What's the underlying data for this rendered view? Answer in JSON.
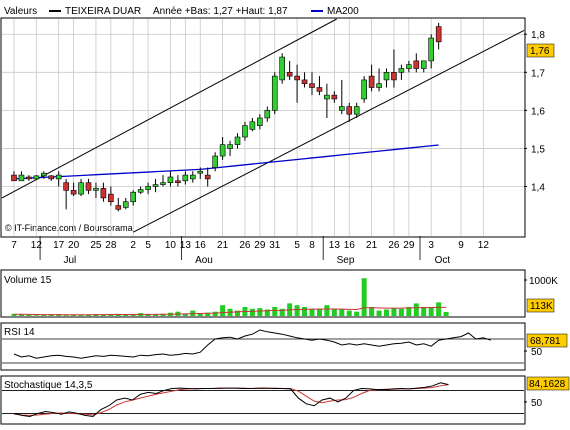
{
  "header": {
    "prefix": "Valeurs",
    "instrument": "TEIXEIRA DUAR",
    "range_text": "Année +Bas: 1,27 +Haut: 1,87",
    "ma_label": "MA200"
  },
  "watermark": "© IT-Finance.com / Boursorama",
  "colors": {
    "up": "#33cc33",
    "down": "#cc3333",
    "ma": "#0000cc",
    "grid": "#c8c8c8",
    "badge": "#ffcc00",
    "volume": "#22cc22",
    "rsi": "#000000",
    "stoch_k": "#000000",
    "stoch_d": "#cc3333"
  },
  "chart_data": [
    {
      "type": "candlestick",
      "title": "TEIXEIRA DUAR",
      "ylim": [
        1.27,
        1.84
      ],
      "y_ticks": [
        "1,8",
        "1,7",
        "1,6",
        "1,5",
        "1,4"
      ],
      "y_tick_values": [
        1.8,
        1.7,
        1.6,
        1.5,
        1.4
      ],
      "last_value_label": "1,76",
      "last_value": 1.76,
      "x_tick_labels": [
        "7",
        "12",
        "17",
        "20",
        "25",
        "28",
        "2",
        "5",
        "10",
        "13",
        "16",
        "21",
        "26",
        "29",
        "31",
        "5",
        "8",
        "13",
        "16",
        "21",
        "26",
        "29",
        "3",
        "9",
        "12"
      ],
      "x_tick_slots": [
        0,
        3,
        6,
        8,
        11,
        13,
        16,
        18,
        21,
        23,
        25,
        28,
        31,
        33,
        35,
        38,
        40,
        43,
        45,
        48,
        51,
        53,
        56,
        60,
        63
      ],
      "month_labels": [
        "Jul",
        "Aou",
        "Sep",
        "Oct"
      ],
      "month_slots": [
        7.5,
        25.5,
        44.5,
        57.5
      ],
      "month_separator_slots": [
        3.5,
        22.5,
        41.5,
        54.5
      ],
      "candles": [
        [
          1.43,
          1.44,
          1.42,
          1.415
        ],
        [
          1.415,
          1.44,
          1.42,
          1.43
        ],
        [
          1.425,
          1.43,
          1.415,
          1.42
        ],
        [
          1.42,
          1.43,
          1.42,
          1.428
        ],
        [
          1.428,
          1.44,
          1.42,
          1.435
        ],
        [
          1.428,
          1.43,
          1.415,
          1.42
        ],
        [
          1.42,
          1.44,
          1.4,
          1.43
        ],
        [
          1.41,
          1.42,
          1.34,
          1.39
        ],
        [
          1.39,
          1.41,
          1.375,
          1.38
        ],
        [
          1.38,
          1.42,
          1.375,
          1.41
        ],
        [
          1.41,
          1.42,
          1.38,
          1.39
        ],
        [
          1.39,
          1.41,
          1.37,
          1.395
        ],
        [
          1.395,
          1.41,
          1.36,
          1.37
        ],
        [
          1.38,
          1.4,
          1.35,
          1.36
        ],
        [
          1.35,
          1.37,
          1.335,
          1.34
        ],
        [
          1.345,
          1.37,
          1.34,
          1.36
        ],
        [
          1.36,
          1.39,
          1.35,
          1.385
        ],
        [
          1.385,
          1.4,
          1.38,
          1.392
        ],
        [
          1.392,
          1.41,
          1.38,
          1.4
        ],
        [
          1.4,
          1.42,
          1.385,
          1.405
        ],
        [
          1.405,
          1.43,
          1.4,
          1.41
        ],
        [
          1.41,
          1.44,
          1.4,
          1.425
        ],
        [
          1.415,
          1.43,
          1.4,
          1.41
        ],
        [
          1.415,
          1.44,
          1.405,
          1.43
        ],
        [
          1.42,
          1.44,
          1.41,
          1.43
        ],
        [
          1.435,
          1.45,
          1.42,
          1.44
        ],
        [
          1.43,
          1.45,
          1.4,
          1.42
        ],
        [
          1.45,
          1.49,
          1.44,
          1.48
        ],
        [
          1.48,
          1.53,
          1.47,
          1.51
        ],
        [
          1.5,
          1.52,
          1.48,
          1.51
        ],
        [
          1.51,
          1.54,
          1.5,
          1.53
        ],
        [
          1.53,
          1.57,
          1.52,
          1.56
        ],
        [
          1.55,
          1.58,
          1.545,
          1.57
        ],
        [
          1.56,
          1.59,
          1.55,
          1.58
        ],
        [
          1.58,
          1.61,
          1.57,
          1.6
        ],
        [
          1.6,
          1.7,
          1.59,
          1.69
        ],
        [
          1.68,
          1.75,
          1.67,
          1.74
        ],
        [
          1.7,
          1.73,
          1.68,
          1.69
        ],
        [
          1.69,
          1.72,
          1.62,
          1.68
        ],
        [
          1.68,
          1.7,
          1.66,
          1.67
        ],
        [
          1.67,
          1.7,
          1.64,
          1.66
        ],
        [
          1.66,
          1.69,
          1.64,
          1.65
        ],
        [
          1.63,
          1.67,
          1.58,
          1.64
        ],
        [
          1.64,
          1.65,
          1.62,
          1.63
        ],
        [
          1.6,
          1.68,
          1.59,
          1.61
        ],
        [
          1.61,
          1.62,
          1.57,
          1.59
        ],
        [
          1.59,
          1.62,
          1.58,
          1.61
        ],
        [
          1.63,
          1.69,
          1.62,
          1.68
        ],
        [
          1.69,
          1.72,
          1.65,
          1.66
        ],
        [
          1.66,
          1.71,
          1.65,
          1.67
        ],
        [
          1.68,
          1.71,
          1.66,
          1.7
        ],
        [
          1.7,
          1.76,
          1.66,
          1.68
        ],
        [
          1.7,
          1.72,
          1.68,
          1.71
        ],
        [
          1.71,
          1.73,
          1.7,
          1.72
        ],
        [
          1.73,
          1.75,
          1.7,
          1.71
        ],
        [
          1.71,
          1.73,
          1.7,
          1.73
        ],
        [
          1.73,
          1.8,
          1.71,
          1.79
        ],
        [
          1.82,
          1.83,
          1.76,
          1.78
        ]
      ],
      "ma200": [
        1.42,
        1.421,
        1.422,
        1.423,
        1.424,
        1.425,
        1.426,
        1.427,
        1.428,
        1.429,
        1.43,
        1.431,
        1.432,
        1.433,
        1.434,
        1.435,
        1.436,
        1.437,
        1.438,
        1.439,
        1.44,
        1.441,
        1.442,
        1.443,
        1.444,
        1.445,
        1.447,
        1.449,
        1.451,
        1.453,
        1.455,
        1.457,
        1.459,
        1.461,
        1.463,
        1.465,
        1.467,
        1.469,
        1.471,
        1.473,
        1.475,
        1.477,
        1.479,
        1.481,
        1.483,
        1.485,
        1.487,
        1.489,
        1.491,
        1.493,
        1.495,
        1.497,
        1.499,
        1.501,
        1.503,
        1.505,
        1.507,
        1.509
      ]
    },
    {
      "type": "bar",
      "title": "Volume 15",
      "y_ticks": [
        "1000K"
      ],
      "y_tick_values": [
        1000
      ],
      "last_value_label": "113K",
      "ylim": [
        0,
        1250
      ],
      "values": [
        60,
        40,
        30,
        20,
        25,
        30,
        45,
        20,
        40,
        25,
        40,
        50,
        40,
        45,
        60,
        30,
        40,
        80,
        50,
        40,
        60,
        90,
        120,
        70,
        150,
        80,
        90,
        120,
        300,
        200,
        150,
        250,
        200,
        220,
        180,
        250,
        200,
        350,
        300,
        250,
        200,
        200,
        300,
        200,
        180,
        150,
        120,
        1050,
        250,
        150,
        180,
        220,
        200,
        250,
        350,
        250,
        250,
        380,
        113
      ],
      "ma_values": [
        50,
        48,
        45,
        40,
        38,
        37,
        38,
        35,
        36,
        34,
        35,
        37,
        38,
        40,
        42,
        40,
        41,
        45,
        46,
        45,
        47,
        50,
        55,
        58,
        65,
        70,
        75,
        80,
        95,
        105,
        115,
        125,
        130,
        140,
        145,
        155,
        160,
        170,
        180,
        185,
        190,
        190,
        195,
        195,
        190,
        185,
        180,
        230,
        230,
        225,
        220,
        220,
        220,
        225,
        230,
        232,
        235,
        240,
        238
      ],
      "ma_color": "#cc3333"
    },
    {
      "type": "line",
      "title": "RSI 14",
      "y_ticks": [
        "50"
      ],
      "y_tick_values": [
        50
      ],
      "last_value_label": "68,781",
      "ylim": [
        20,
        95
      ],
      "values": [
        45,
        40,
        42,
        38,
        40,
        42,
        43,
        41,
        40,
        38,
        40,
        42,
        41,
        43,
        42,
        41,
        40,
        43,
        42,
        44,
        45,
        43,
        44,
        46,
        45,
        48,
        60,
        70,
        72,
        73,
        70,
        75,
        78,
        85,
        82,
        80,
        78,
        75,
        72,
        70,
        68,
        70,
        68,
        65,
        60,
        62,
        60,
        62,
        60,
        58,
        60,
        62,
        63,
        65,
        60,
        62,
        58,
        68,
        70,
        72,
        74,
        80,
        70,
        72,
        68
      ]
    },
    {
      "type": "line",
      "title": "Stochastique 14,3,5",
      "y_ticks": [
        "50"
      ],
      "y_tick_values": [
        50
      ],
      "last_value_label": "84,1628",
      "ylim": [
        -5,
        115
      ],
      "k_values": [
        20,
        15,
        12,
        20,
        25,
        22,
        18,
        24,
        20,
        15,
        12,
        30,
        40,
        55,
        60,
        55,
        70,
        75,
        72,
        80,
        85,
        86,
        85,
        84,
        85,
        85,
        86,
        86,
        86,
        85,
        85,
        86,
        86,
        85,
        85,
        84,
        60,
        45,
        40,
        55,
        60,
        50,
        60,
        80,
        85,
        84,
        82,
        82,
        84,
        85,
        84,
        86,
        88,
        92,
        100,
        95
      ],
      "d_values": [
        18,
        16,
        15,
        16,
        18,
        20,
        21,
        20,
        19,
        18,
        16,
        22,
        30,
        42,
        50,
        55,
        60,
        65,
        70,
        74,
        78,
        82,
        84,
        85,
        85,
        85,
        85,
        86,
        86,
        86,
        85,
        85,
        85,
        86,
        85,
        85,
        78,
        65,
        52,
        48,
        52,
        55,
        56,
        62,
        72,
        80,
        82,
        83,
        83,
        84,
        84,
        85,
        86,
        88,
        92,
        95
      ]
    }
  ]
}
